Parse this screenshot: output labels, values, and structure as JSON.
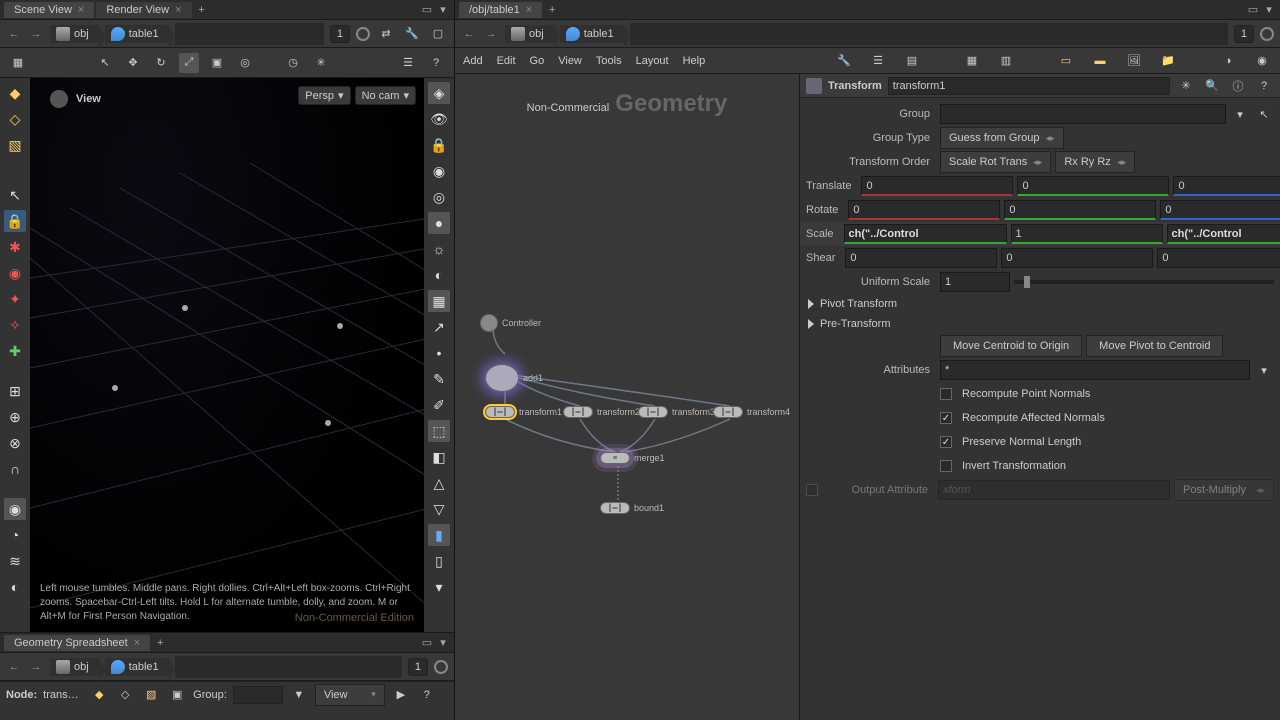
{
  "left": {
    "tabs": [
      "Scene View",
      "Render View"
    ],
    "active_tab": 0,
    "breadcrumb": {
      "levels": [
        "obj",
        "table1"
      ],
      "index": "1"
    },
    "view_label": "View",
    "persp": "Persp",
    "cam": "No cam",
    "hint": "Left mouse tumbles. Middle pans. Right dollies. Ctrl+Alt+Left box-zooms. Ctrl+Right zooms. Spacebar-Ctrl-Left tilts. Hold L for alternate tumble, dolly, and zoom. M or Alt+M for First Person Navigation.",
    "watermark": "Non-Commercial Edition",
    "spreadsheet": {
      "tab": "Geometry Spreadsheet",
      "breadcrumb": {
        "levels": [
          "obj",
          "table1"
        ],
        "index": "1"
      },
      "node_label": "Node:",
      "node_value": "trans…",
      "group_label": "Group:",
      "view_label": "View"
    }
  },
  "right": {
    "tabs": [
      "/obj/table1"
    ],
    "breadcrumb": {
      "levels": [
        "obj",
        "table1"
      ],
      "index": "1"
    },
    "menus": [
      "Add",
      "Edit",
      "Go",
      "View",
      "Tools",
      "Layout",
      "Help"
    ],
    "network": {
      "watermark_a": "Non-Commercial",
      "watermark_b": "Geometry",
      "nodes": {
        "controller": "Controller",
        "add1": "add1",
        "transform1": "transform1",
        "transform2": "transform2",
        "transform3": "transform3",
        "transform4": "transform4",
        "merge1": "merge1",
        "bound1": "bound1"
      }
    },
    "params": {
      "op_type": "Transform",
      "op_name": "transform1",
      "group_label": "Group",
      "group_value": "",
      "group_type_label": "Group Type",
      "group_type_value": "Guess from Group",
      "xord_label": "Transform Order",
      "xord_value": "Scale Rot Trans",
      "rord_value": "Rx Ry Rz",
      "translate_label": "Translate",
      "translate": [
        "0",
        "0",
        "0"
      ],
      "rotate_label": "Rotate",
      "rotate": [
        "0",
        "0",
        "0"
      ],
      "scale_label": "Scale",
      "scale": [
        "ch(\"../Control",
        "1",
        "ch(\"../Control"
      ],
      "shear_label": "Shear",
      "shear": [
        "0",
        "0",
        "0"
      ],
      "uscale_label": "Uniform Scale",
      "uscale": "1",
      "pivot_label": "Pivot Transform",
      "prexform_label": "Pre-Transform",
      "move_centroid": "Move Centroid to Origin",
      "move_pivot": "Move Pivot to Centroid",
      "attrs_label": "Attributes",
      "attrs_value": "*",
      "chk_recompute_pt": "Recompute Point Normals",
      "chk_recompute_aff": "Recompute Affected Normals",
      "chk_preserve": "Preserve Normal Length",
      "chk_invert": "Invert Transformation",
      "output_attr_label": "Output Attribute",
      "output_attr_ph": "xform",
      "output_mode": "Post-Multiply"
    }
  }
}
